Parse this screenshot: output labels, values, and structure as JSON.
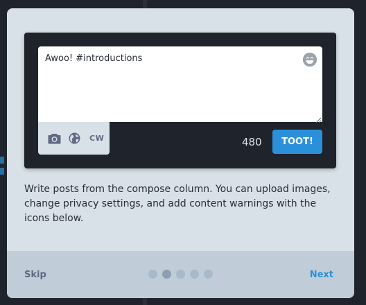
{
  "colors": {
    "accent": "#2b90d9",
    "modal_bg": "#d9e1e8",
    "dark_bg": "#1f232b",
    "footer_bg": "#c0cdd9"
  },
  "compose": {
    "text": "Awoo! #introductions",
    "emoji_icon": "grinning-face-icon",
    "tools": {
      "camera_icon": "camera-icon",
      "privacy_icon": "globe-icon",
      "cw_label": "CW"
    },
    "counter": "480",
    "submit_label": "TOOT!"
  },
  "description": "Write posts from the compose column. You can upload images, change privacy settings, and add content warnings with the icons below.",
  "footer": {
    "skip_label": "Skip",
    "next_label": "Next",
    "pages": 5,
    "current_page": 2
  }
}
